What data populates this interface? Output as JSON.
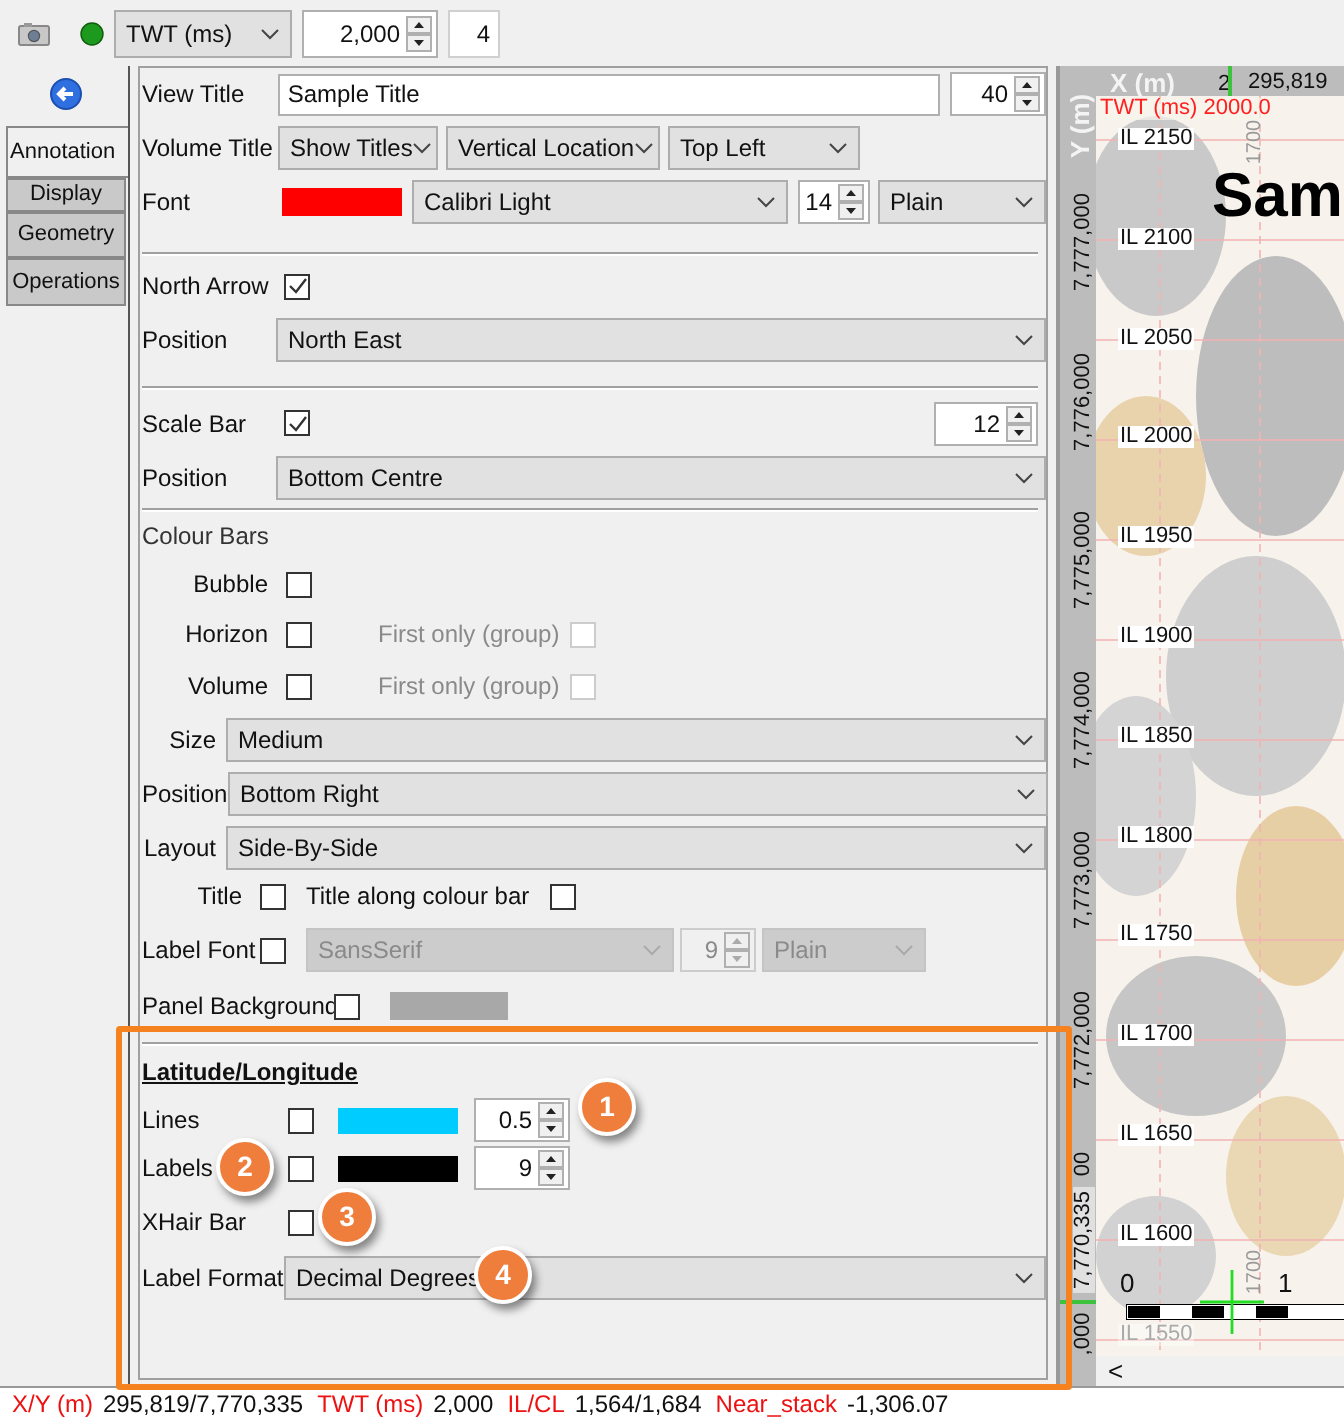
{
  "toolbar": {
    "domain": "TWT (ms)",
    "value": "2,000",
    "step": "4"
  },
  "tabs": [
    {
      "label": "Annotation",
      "selected": true
    },
    {
      "label": "Display",
      "selected": false
    },
    {
      "label": "Geometry",
      "selected": false
    },
    {
      "label": "Operations",
      "selected": false
    }
  ],
  "panel": {
    "view_title": {
      "label": "View Title",
      "value": "Sample Title",
      "size": "40"
    },
    "volume_title": {
      "label": "Volume Title",
      "mode": "Show Titles",
      "vertical": "Vertical Location",
      "location": "Top Left"
    },
    "font": {
      "label": "Font",
      "color": "#ff0000",
      "family": "Calibri Light",
      "size": "14",
      "style": "Plain"
    },
    "north_arrow": {
      "label": "North Arrow",
      "checked": true,
      "position_label": "Position",
      "position": "North East"
    },
    "scale_bar": {
      "label": "Scale Bar",
      "checked": true,
      "size": "12",
      "position_label": "Position",
      "position": "Bottom Centre"
    },
    "colour_bars": {
      "heading": "Colour Bars",
      "toggles": [
        {
          "label": "Bubble",
          "checked": false
        },
        {
          "label": "Horizon",
          "checked": false,
          "first_only": {
            "label": "First only (group)",
            "checked": false,
            "disabled": true
          }
        },
        {
          "label": "Volume",
          "checked": false,
          "first_only": {
            "label": "First only (group)",
            "checked": false,
            "disabled": true
          }
        }
      ],
      "size": {
        "label": "Size",
        "value": "Medium"
      },
      "position": {
        "label": "Position",
        "value": "Bottom Right"
      },
      "layout": {
        "label": "Layout",
        "value": "Side-By-Side"
      },
      "title": {
        "label": "Title",
        "checked": false
      },
      "title_along": {
        "label": "Title along colour bar",
        "checked": false
      },
      "label_font": {
        "label": "Label Font",
        "checked": false,
        "disabled": true,
        "family": "SansSerif",
        "size": "9",
        "style": "Plain"
      },
      "panel_background": {
        "label": "Panel Background",
        "checked": false,
        "color": "#a8a8a8"
      }
    },
    "lat_long": {
      "heading": "Latitude/Longitude",
      "lines": {
        "label": "Lines",
        "checked": false,
        "color": "#00ccff",
        "value": "0.5"
      },
      "labels": {
        "label": "Labels",
        "checked": false,
        "color": "#000000",
        "value": "9"
      },
      "xhair": {
        "label": "XHair Bar",
        "checked": false
      },
      "label_format": {
        "label": "Label Format",
        "value": "Decimal Degrees"
      }
    }
  },
  "callouts": [
    {
      "text": "1"
    },
    {
      "text": "2"
    },
    {
      "text": "3"
    },
    {
      "text": "4"
    }
  ],
  "map": {
    "x_axis_label": "X (m)",
    "x_cursor_tick": "2",
    "x_cursor_value": "295,819",
    "y_axis_label": "Y (m)",
    "time_label": "TWT (ms) 2000.0",
    "title_fragment": "Sam",
    "crossline_labels": [
      "1700",
      "1700"
    ],
    "inline_labels": [
      "IL 2150",
      "IL 2100",
      "IL 2050",
      "IL 2000",
      "IL 1950",
      "IL 1900",
      "IL 1850",
      "IL 1800",
      "IL 1750",
      "IL 1700",
      "IL 1650",
      "IL 1600",
      "IL 1550"
    ],
    "y_ticks": [
      "7,777,000",
      "7,776,000",
      "7,775,000",
      "7,774,000",
      "7,773,000",
      "7,772,000",
      "00"
    ],
    "y_cursor_value": "7,770,335",
    "y_tick_tail": ",000",
    "scale_labels": [
      "0",
      "1"
    ],
    "scroll_arrow": "<"
  },
  "status_bar": [
    {
      "label": "X/Y (m)",
      "value": "295,819/7,770,335"
    },
    {
      "label": "TWT (ms)",
      "value": "2,000"
    },
    {
      "label": "IL/CL",
      "value": "1,564/1,684"
    },
    {
      "label": "Near_stack",
      "value": "-1,306.07"
    }
  ]
}
